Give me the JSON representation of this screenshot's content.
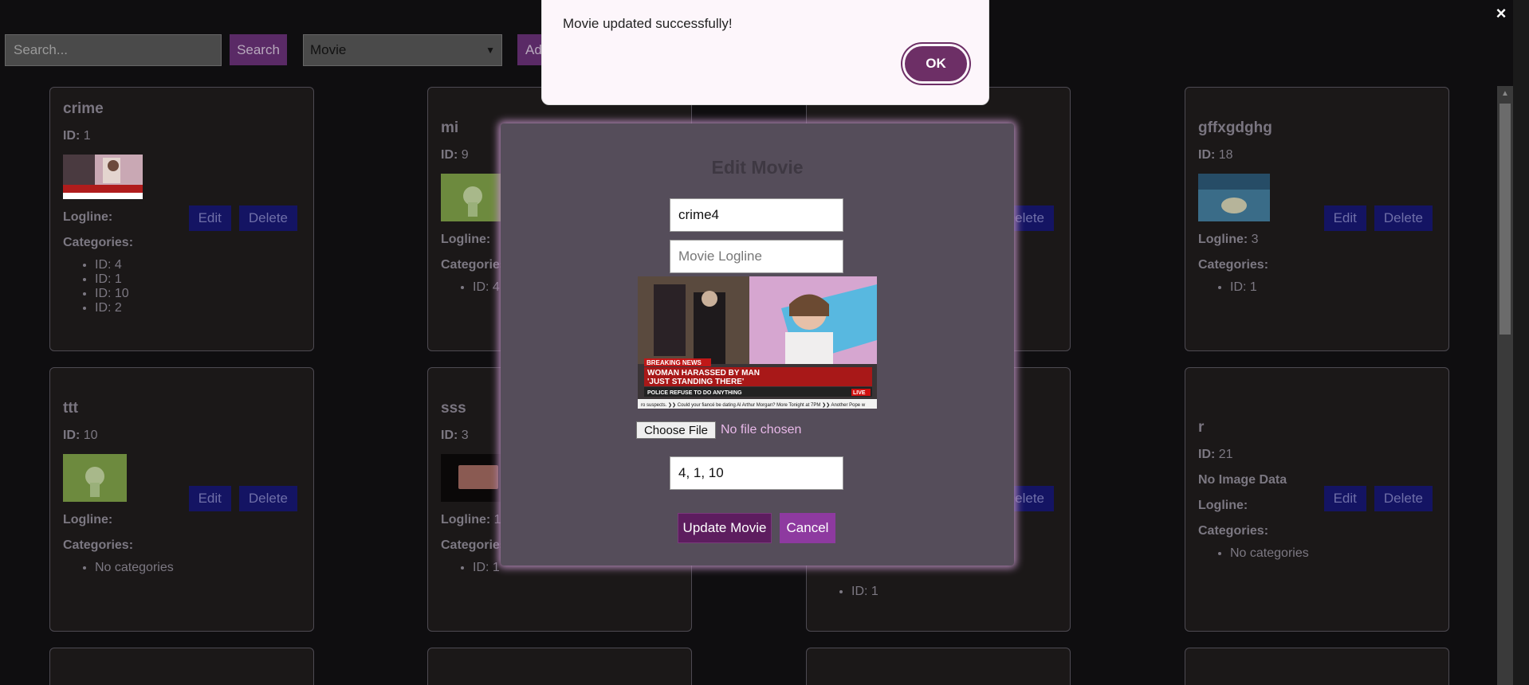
{
  "topbar": {
    "search_placeholder": "Search...",
    "search_label": "Search",
    "type_selected": "Movie",
    "add_label": "Add",
    "close_symbol": "×"
  },
  "cards": [
    {
      "title": "crime",
      "id_label": "ID:",
      "id": "1",
      "logline_label": "Logline:",
      "logline": "",
      "categories_label": "Categories:",
      "categories": [
        "ID: 4",
        "ID: 1",
        "ID: 10",
        "ID: 2"
      ],
      "image": "news-still"
    },
    {
      "title": "mi",
      "id_label": "ID:",
      "id": "9",
      "logline_label": "Logline:",
      "logline": "",
      "categories_label": "Categories:",
      "categories": [
        "ID: 4"
      ],
      "image": "green-figure"
    },
    {
      "title": "",
      "id_label": "",
      "id": "",
      "logline_label": "",
      "logline": "",
      "categories_label": "",
      "categories": [],
      "image": ""
    },
    {
      "title": "gffxgdghg",
      "id_label": "ID:",
      "id": "18",
      "logline_label": "Logline:",
      "logline": "3",
      "categories_label": "Categories:",
      "categories": [
        "ID: 1"
      ],
      "image": "pool-figure"
    },
    {
      "title": "ttt",
      "id_label": "ID:",
      "id": "10",
      "logline_label": "Logline:",
      "logline": "",
      "categories_label": "Categories:",
      "categories": [
        "No categories"
      ],
      "image": "green-figure"
    },
    {
      "title": "sss",
      "id_label": "ID:",
      "id": "3",
      "logline_label": "Logline:",
      "logline": "1!",
      "categories_label": "Categories:",
      "categories": [
        "ID: 1"
      ],
      "image": "brown-box"
    },
    {
      "title": "",
      "id_label": "",
      "id": "",
      "logline_label": "",
      "logline": "",
      "categories_label": "",
      "categories": [
        "ID: 1"
      ],
      "image": ""
    },
    {
      "title": "r",
      "id_label": "ID:",
      "id": "21",
      "no_image": "No Image Data",
      "logline_label": "Logline:",
      "logline": "",
      "categories_label": "Categories:",
      "categories": [
        "No categories"
      ],
      "image": ""
    }
  ],
  "card_buttons": {
    "edit": "Edit",
    "delete": "Delete"
  },
  "modal": {
    "title": "Edit Movie",
    "name_value": "crime4",
    "logline_placeholder": "Movie Logline",
    "image_caption": {
      "tag": "BREAKING NEWS",
      "headline_1": "WOMAN HARASSED BY MAN",
      "headline_2": "'JUST STANDING THERE'",
      "sub": "POLICE REFUSE TO DO ANYTHING",
      "ticker": "ro suspects. ❯❯ Could your fiancé be dating Al Arthur Morgan? More Tonight at 7PM ❯❯ Another Pope w",
      "live": "LIVE"
    },
    "choose_file_label": "Choose File",
    "no_file_text": "No file chosen",
    "categories_value": "4, 1, 10",
    "update_label": "Update Movie",
    "cancel_label": "Cancel"
  },
  "alert": {
    "message": "Movie updated successfully!",
    "ok_label": "OK"
  },
  "colors": {
    "accent": "#5a2a66",
    "edit_button": "#141463",
    "modal_bg": "#554d5a",
    "alert_ok": "#6d2f66"
  }
}
